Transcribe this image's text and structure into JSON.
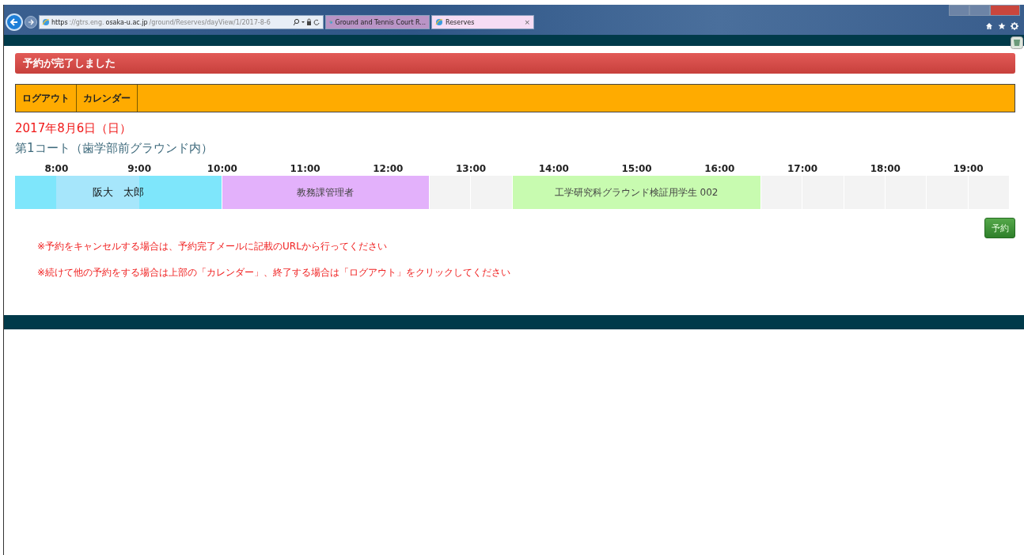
{
  "browser": {
    "address": {
      "scheme": "https",
      "separator": "://gtrs.eng.",
      "host": "osaka-u.ac.jp",
      "path": "/ground/Reserves/dayView/1/2017-8-6"
    },
    "tabs": [
      {
        "label": "Ground and Tennis Court R...",
        "selected": false
      },
      {
        "label": "Reserves",
        "selected": true,
        "close": "×"
      }
    ]
  },
  "banner": {
    "text": "予約が完了しました"
  },
  "nav": [
    {
      "label": "ログアウト"
    },
    {
      "label": "カレンダー"
    }
  ],
  "date": "2017年8月6日（日）",
  "court": "第1コート（歯学部前グラウンド内）",
  "timeline": {
    "hours": [
      "8:00",
      "9:00",
      "10:00",
      "11:00",
      "12:00",
      "13:00",
      "14:00",
      "15:00",
      "16:00",
      "17:00",
      "18:00",
      "19:00"
    ],
    "slots": [
      {
        "kind": "booked",
        "color": "#7ee6fb",
        "name": "阪大　太郎"
      },
      {
        "kind": "booked",
        "color": "#a6e6fb"
      },
      {
        "kind": "booked",
        "color": "#a6e6fb"
      },
      {
        "kind": "booked",
        "color": "#7ee6fb"
      },
      {
        "kind": "booked",
        "color": "#7ee6fb"
      },
      {
        "kind": "booked",
        "color": "#e3b1fb",
        "name": "教務課管理者"
      },
      {
        "kind": "booked",
        "color": "#e3b1fb"
      },
      {
        "kind": "booked",
        "color": "#e3b1fb"
      },
      {
        "kind": "booked",
        "color": "#e3b1fb"
      },
      {
        "kind": "booked",
        "color": "#e3b1fb"
      },
      {
        "kind": "free"
      },
      {
        "kind": "free"
      },
      {
        "kind": "booked",
        "color": "#c8fbb0",
        "name": "工学研究科グラウンド検証用学生 002"
      },
      {
        "kind": "booked",
        "color": "#c8fbb0"
      },
      {
        "kind": "booked",
        "color": "#c8fbb0"
      },
      {
        "kind": "booked",
        "color": "#c8fbb0"
      },
      {
        "kind": "booked",
        "color": "#c8fbb0"
      },
      {
        "kind": "booked",
        "color": "#c8fbb0"
      },
      {
        "kind": "free"
      },
      {
        "kind": "free"
      },
      {
        "kind": "free"
      },
      {
        "kind": "free"
      },
      {
        "kind": "free"
      },
      {
        "kind": "free"
      }
    ]
  },
  "reserve_button": "予約",
  "notes": [
    "※予約をキャンセルする場合は、予約完了メールに記載のURLから行ってください",
    "※続けて他の予約をする場合は上部の「カレンダー」、終了する場合は「ログアウト」をクリックしてください"
  ]
}
